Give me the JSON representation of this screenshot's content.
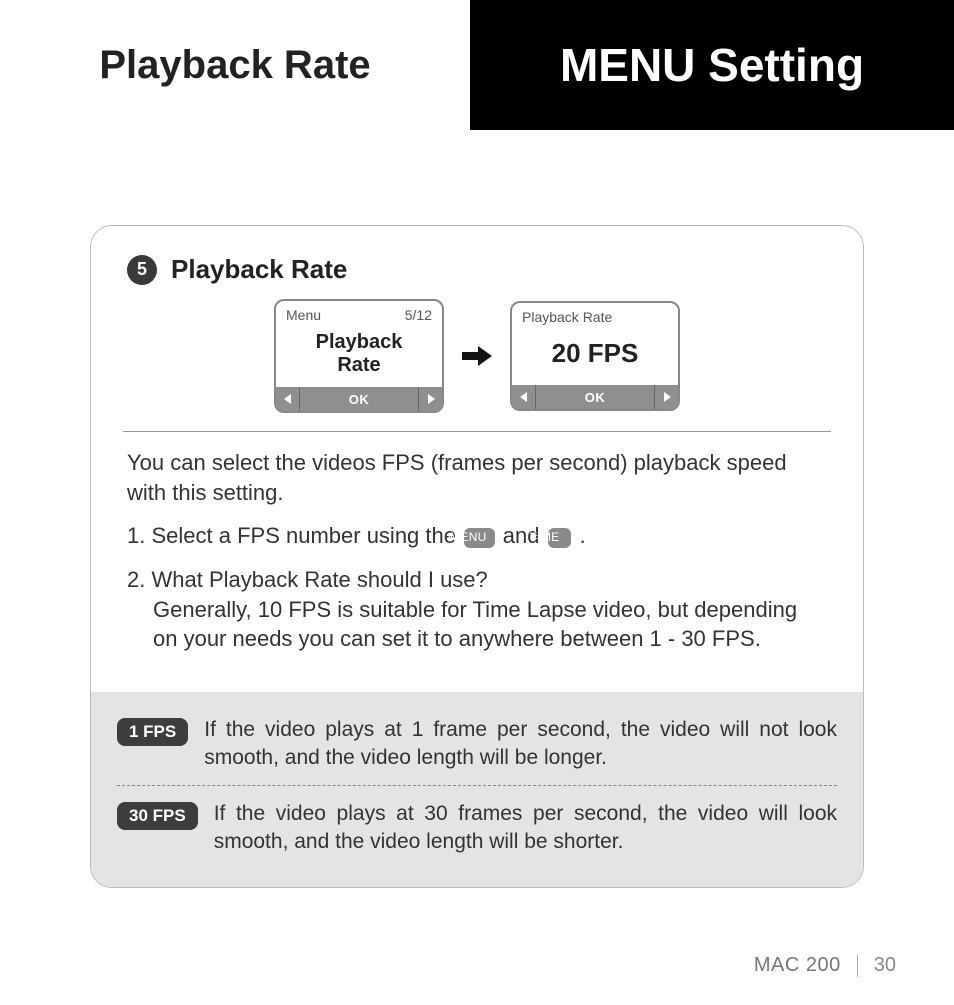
{
  "header": {
    "left_title": "Playback Rate",
    "right_title": "MENU Setting"
  },
  "step": {
    "number": "5",
    "title": "Playback Rate"
  },
  "lcd_left": {
    "top_left": "Menu",
    "top_right": "5/12",
    "center_line1": "Playback",
    "center_line2": "Rate",
    "ok": "OK"
  },
  "lcd_right": {
    "top_left": "Playback Rate",
    "center": "20 FPS",
    "ok": "OK"
  },
  "intro": "You can select the videos FPS (frames per second) playback speed with this setting.",
  "list": {
    "item1_before": "Select a FPS number using the ",
    "item1_btn1_left": "<",
    "item1_btn1_text": "MENU",
    "item1_mid": " and ",
    "item1_btn2_text": "TIME",
    "item1_btn2_right": ">",
    "item1_after": " .",
    "item2_q": "What Playback Rate should I use?",
    "item2_a": "Generally, 10 FPS is suitable for Time Lapse video, but depending on your needs you can  set it to anywhere between 1 - 30 FPS."
  },
  "tips": {
    "t1_badge": "1 FPS",
    "t1_text": "If the video plays at 1 frame per second, the video will not look smooth, and the video length will be longer.",
    "t2_badge": "30 FPS",
    "t2_text": "If the video plays at 30 frames per second, the video will look smooth, and the video length will be shorter."
  },
  "footer": {
    "model": "MAC 200",
    "page": "30"
  }
}
